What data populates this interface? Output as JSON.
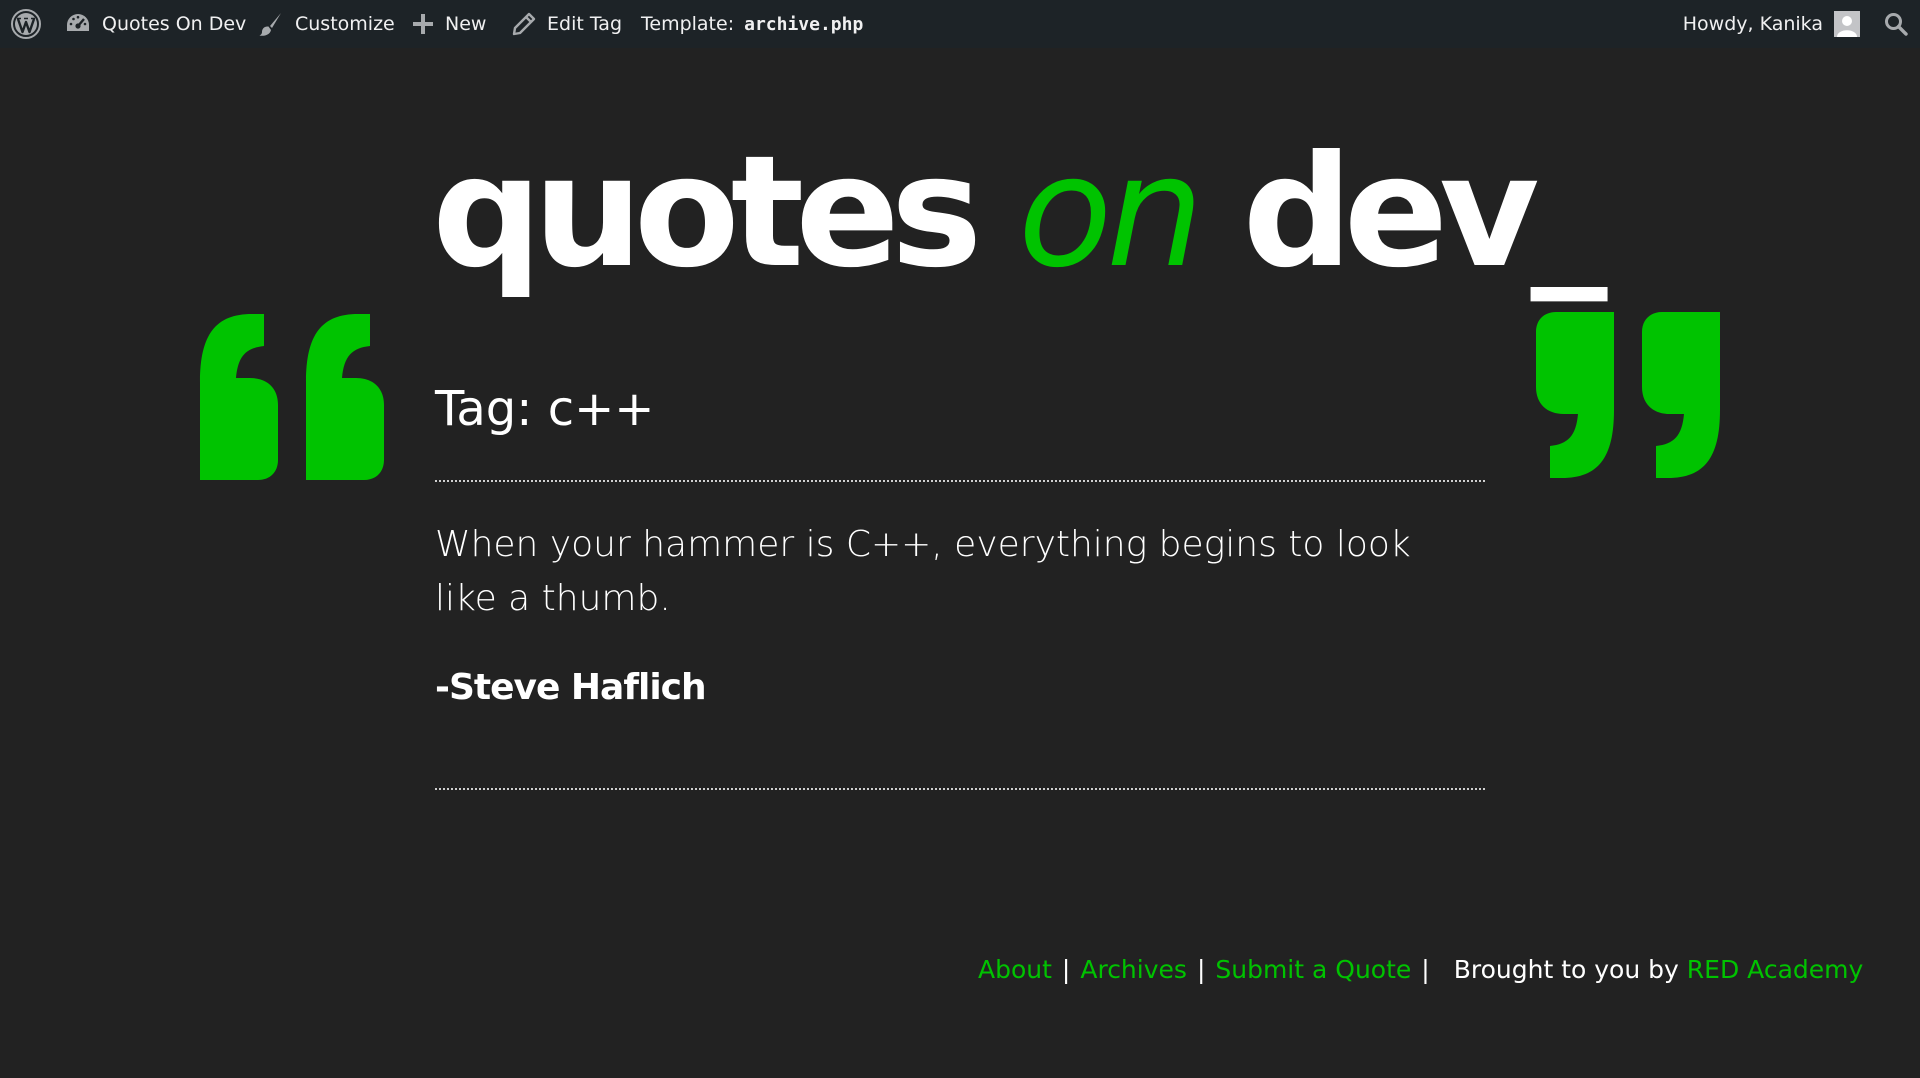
{
  "admin_bar": {
    "site_name": "Quotes On Dev",
    "customize": "Customize",
    "new": "New",
    "edit_tag": "Edit Tag",
    "template_label": "Template:",
    "template_file": "archive.php",
    "greeting": "Howdy, Kanika"
  },
  "site": {
    "title_part1": "quotes",
    "title_part2": "on",
    "title_part3": "dev_"
  },
  "page": {
    "heading": "Tag: c++"
  },
  "quote": {
    "text": "When your hammer is C++, everything begins to look like a thumb.",
    "author": "-Steve Haflich"
  },
  "footer": {
    "about": "About",
    "archives": "Archives",
    "submit": "Submit a Quote",
    "separator": "|",
    "credit_text": "Brought to you by",
    "credit_link": "RED Academy"
  },
  "colors": {
    "background": "#222222",
    "admin_bar": "#1d2327",
    "accent": "#00c300",
    "text": "#ffffff"
  },
  "icons": [
    "wordpress-logo-icon",
    "dashboard-icon",
    "paintbrush-icon",
    "plus-icon",
    "pencil-icon",
    "user-avatar-icon",
    "search-icon",
    "open-quote-icon",
    "close-quote-icon"
  ]
}
